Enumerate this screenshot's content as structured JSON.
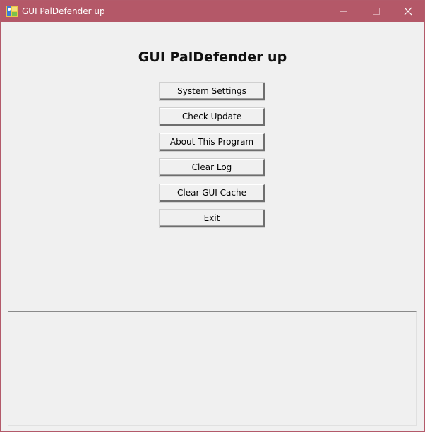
{
  "window": {
    "title": "GUI PalDefender up"
  },
  "titlebar_icons": {
    "app": "app-icon",
    "minimize": "minimize-icon",
    "maximize": "maximize-icon",
    "close": "close-icon"
  },
  "main": {
    "heading": "GUI PalDefender up",
    "buttons": [
      {
        "label": "System Settings"
      },
      {
        "label": "Check Update"
      },
      {
        "label": "About This Program"
      },
      {
        "label": "Clear Log"
      },
      {
        "label": "Clear GUI Cache"
      },
      {
        "label": "Exit"
      }
    ]
  },
  "log": {
    "content": ""
  },
  "colors": {
    "titlebar": "#b45868",
    "window_bg": "#f0f0f0",
    "border": "#b35a6a"
  }
}
